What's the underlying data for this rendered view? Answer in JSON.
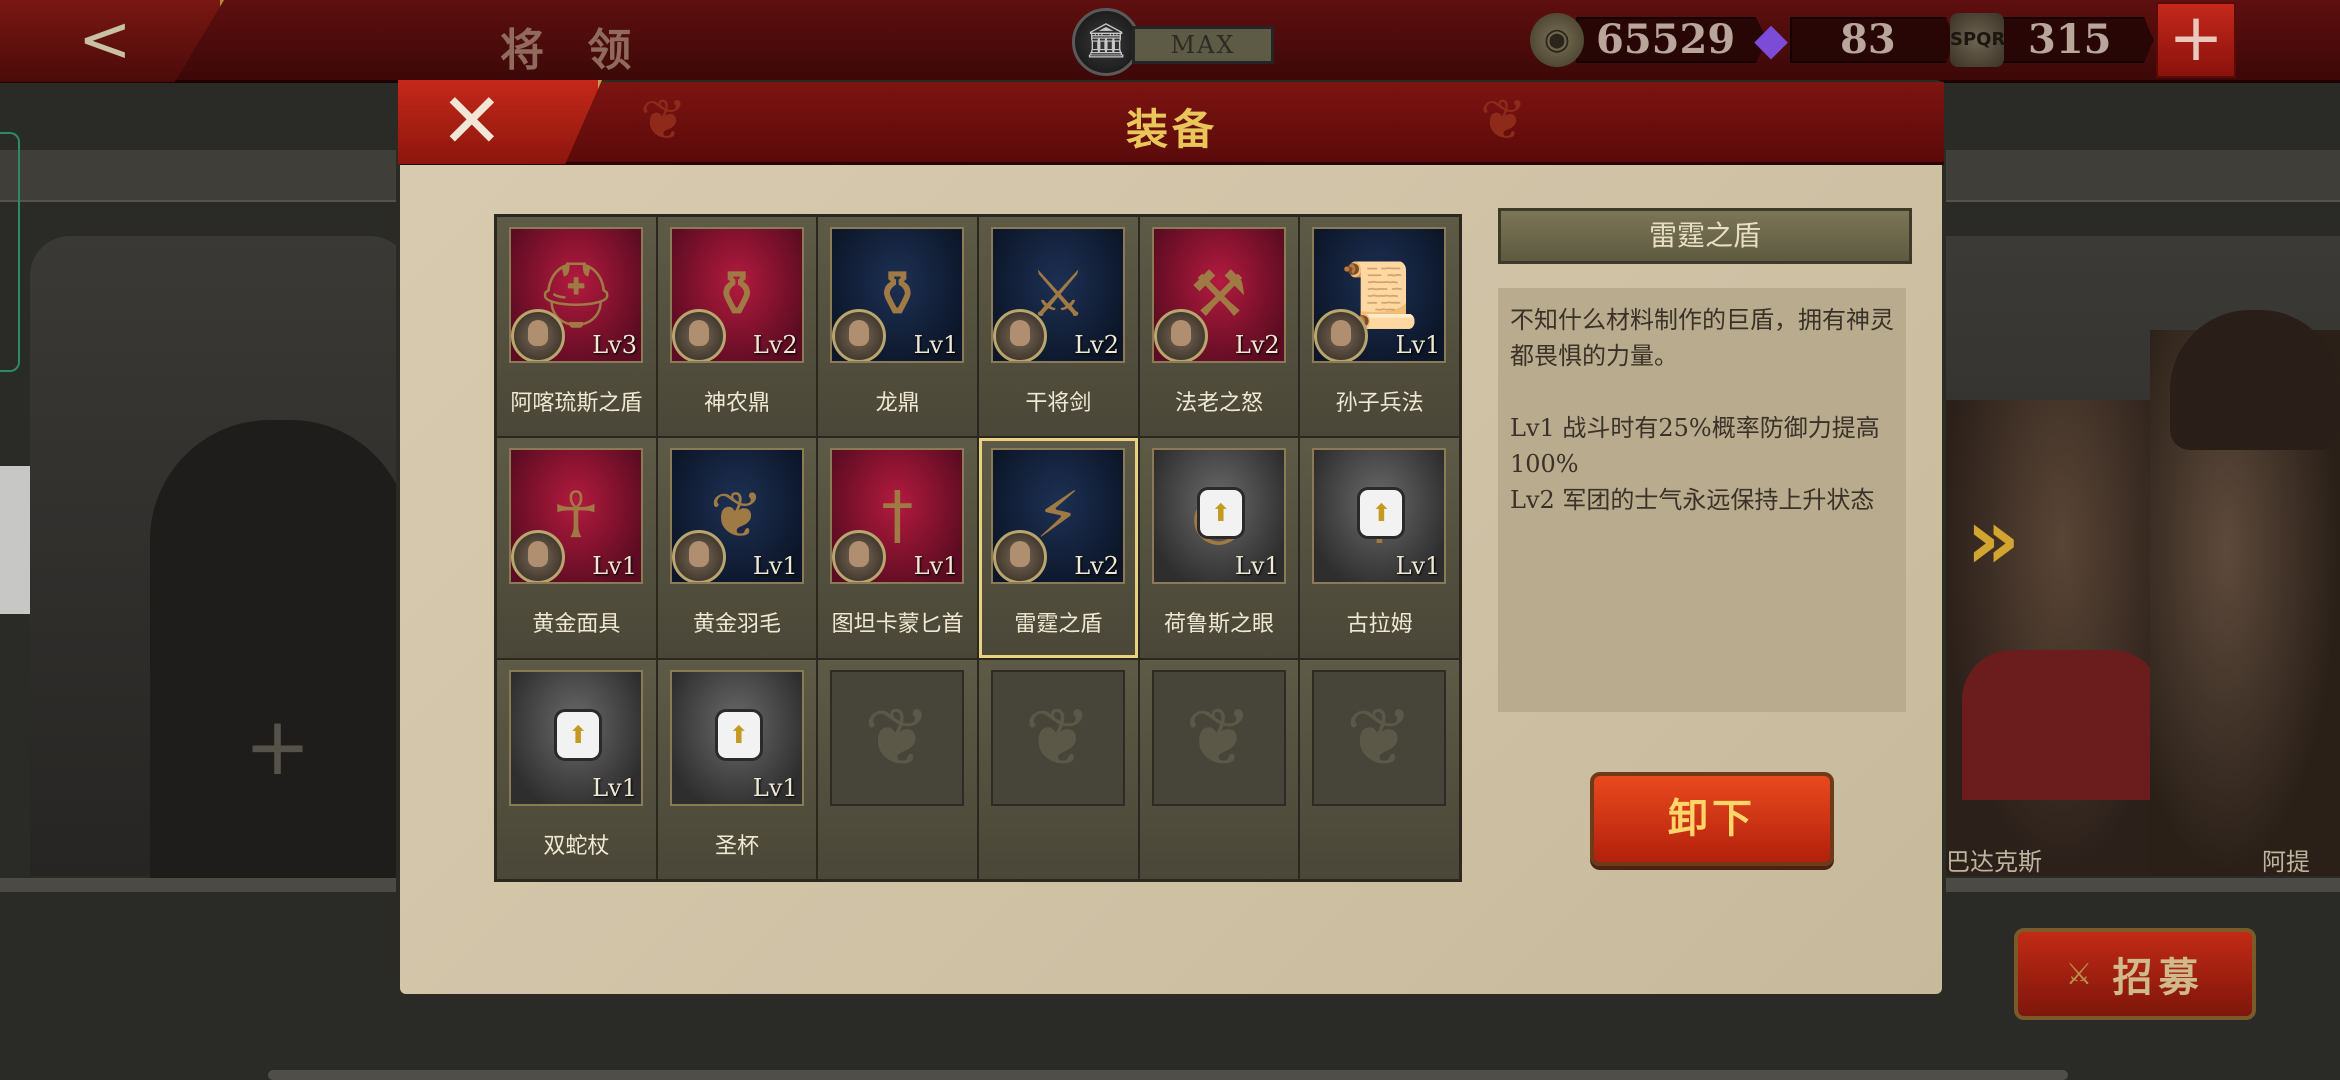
{
  "topbar": {
    "title": "将 领",
    "level_badge": "MAX",
    "coins": "65529",
    "gems": "83",
    "honor": "315",
    "plus": "+"
  },
  "background": {
    "hero_a_name": "巴达克斯",
    "hero_b_name": "阿提",
    "recruit_label": "招募"
  },
  "modal": {
    "title": "装备",
    "close": "✕"
  },
  "items": [
    {
      "name": "阿喀琉斯之盾",
      "level": "Lv3",
      "bg": "red",
      "icon": "helmet-icon",
      "glyph": "⛑",
      "locked": false
    },
    {
      "name": "神农鼎",
      "level": "Lv2",
      "bg": "red",
      "icon": "cauldron-icon",
      "glyph": "⚱",
      "locked": false
    },
    {
      "name": "龙鼎",
      "level": "Lv1",
      "bg": "navy",
      "icon": "vessel-icon",
      "glyph": "⚱",
      "locked": false
    },
    {
      "name": "干将剑",
      "level": "Lv2",
      "bg": "navy",
      "icon": "sword-icon",
      "glyph": "⚔",
      "locked": false
    },
    {
      "name": "法老之怒",
      "level": "Lv2",
      "bg": "red",
      "icon": "axe-icon",
      "glyph": "⚒",
      "locked": false
    },
    {
      "name": "孙子兵法",
      "level": "Lv1",
      "bg": "navy",
      "icon": "scroll-icon",
      "glyph": "📜",
      "locked": false
    },
    {
      "name": "黄金面具",
      "level": "Lv1",
      "bg": "red",
      "icon": "golden-mask-icon",
      "glyph": "☥",
      "locked": false
    },
    {
      "name": "黄金羽毛",
      "level": "Lv1",
      "bg": "navy",
      "icon": "golden-feather-icon",
      "glyph": "❦",
      "locked": false
    },
    {
      "name": "图坦卡蒙匕首",
      "level": "Lv1",
      "bg": "red",
      "icon": "dagger-icon",
      "glyph": "†",
      "locked": false
    },
    {
      "name": "雷霆之盾",
      "level": "Lv2",
      "bg": "navy",
      "icon": "thunder-shield-icon",
      "glyph": "⚡",
      "locked": false,
      "selected": true
    },
    {
      "name": "荷鲁斯之眼",
      "level": "Lv1",
      "bg": "gray",
      "icon": "eye-of-horus-icon",
      "glyph": "◉",
      "locked": true
    },
    {
      "name": "古拉姆",
      "level": "Lv1",
      "bg": "gray",
      "icon": "dagger-icon",
      "glyph": "†",
      "locked": true
    },
    {
      "name": "双蛇杖",
      "level": "Lv1",
      "bg": "gray",
      "icon": "caduceus-icon",
      "glyph": "⚕",
      "locked": true
    },
    {
      "name": "圣杯",
      "level": "Lv1",
      "bg": "gray",
      "icon": "chalice-icon",
      "glyph": "♆",
      "locked": true
    }
  ],
  "empty_slots": 4,
  "detail": {
    "title": "雷霆之盾",
    "description": "不知什么材料制作的巨盾，拥有神灵都畏惧的力量。",
    "lv1": "Lv1  战斗时有25%概率防御力提高100%",
    "lv2": "Lv2  军团的士气永远保持上升状态",
    "action_label": "卸下"
  }
}
